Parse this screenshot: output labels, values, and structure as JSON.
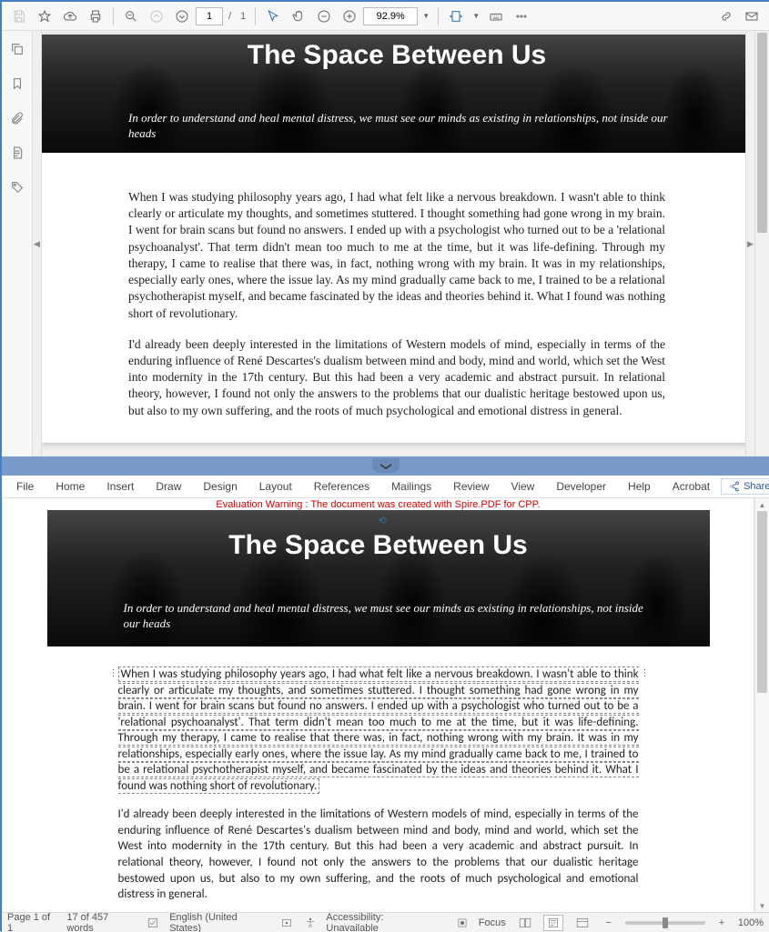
{
  "pdf": {
    "toolbar": {
      "page_current": "1",
      "page_sep": "/",
      "page_total": "1",
      "zoom": "92.9%"
    },
    "hero": {
      "title": "The Space Between Us",
      "subtitle": "In order to understand and heal mental distress, we must see our minds as existing in relationships, not inside our heads"
    },
    "body": {
      "p1": "When I was studying philosophy years ago, I had what felt like a nervous breakdown. I wasn't able to think clearly or articulate my thoughts, and sometimes stuttered. I thought something had gone wrong in my brain. I went for brain scans but found no answers. I ended up with a psychologist who turned out to be a 'relational psychoanalyst'. That term didn't mean too much to me at the time, but it was life-defining. Through my therapy, I came to realise that there was, in fact, nothing wrong with my brain. It was in my relationships, especially early ones, where the issue lay. As my mind gradually came back to me, I trained to be a relational psychotherapist myself, and became fascinated by the ideas and theories behind it. What I found was nothing short of revolutionary.",
      "p2": "I'd already been deeply interested in the limitations of Western models of mind, especially in terms of the enduring influence of René Descartes's dualism between mind and body, mind and world, which set the West into modernity in the 17th century. But this had been a very academic and abstract pursuit. In relational theory, however, I found not only the answers to the problems that our dualistic heritage bestowed upon us, but also to my own suffering, and the roots of much psychological and emotional distress in general."
    }
  },
  "word": {
    "menu": {
      "file": "File",
      "home": "Home",
      "insert": "Insert",
      "draw": "Draw",
      "design": "Design",
      "layout": "Layout",
      "references": "References",
      "mailings": "Mailings",
      "review": "Review",
      "view": "View",
      "developer": "Developer",
      "help": "Help",
      "acrobat": "Acrobat",
      "share": "Share"
    },
    "eval_warning": "Evaluation Warning : The document was created with Spire.PDF for CPP.",
    "hero": {
      "title": "The Space Between Us",
      "subtitle": "In order to understand and heal mental distress, we must see our minds as existing in relationships, not inside our heads"
    },
    "body": {
      "p1": "When I  was studying  philosophy years  ago, I  had what  felt like  a nervous  breakdown. I  wasn't able to  think  clearly or  articulate my  thoughts, and  sometimes stuttered.  I thought  something had gone  wrong  in my  brain. I  went for  brain scans  but  found no  answers. I  ended up  with a psychologist who turned out  to be a 'relational psychoanalyst'.  That term didn't mean too  much to me at the  time, but it was life-defining. Through  my therapy, I came to realise that  there was, in fact, nothing wrong  with my brain. It was in my  relationships, especially early ones, where the issue lay.  As  my mind  gradually came  back to  me,  I trained  to be  a relational  psychotherapist myself, and  became fascinated  by the  ideas  and theories  behind it.  What I  found was  nothing short of revolutionary.",
      "p2": "I'd already  been  deeply interested  in the  limitations  of Western  models of  mind,  especially in terms of the  enduring influence of René Descartes's  dualism between mind and  body, mind and world, which set the West into modernity in  the 17th century. But this had been a very academic and abstract pursuit. In relational theory, however, I  found not only the answers to the problems that  our dualistic  heritage bestowed  upon  us, but  also  to my  own  suffering, and  the roots  of much psychological and emotional distress in general."
    },
    "status": {
      "page": "Page 1 of 1",
      "words": "17 of 457 words",
      "lang": "English (United States)",
      "access": "Accessibility: Unavailable",
      "focus": "Focus",
      "zoom": "100%"
    }
  }
}
